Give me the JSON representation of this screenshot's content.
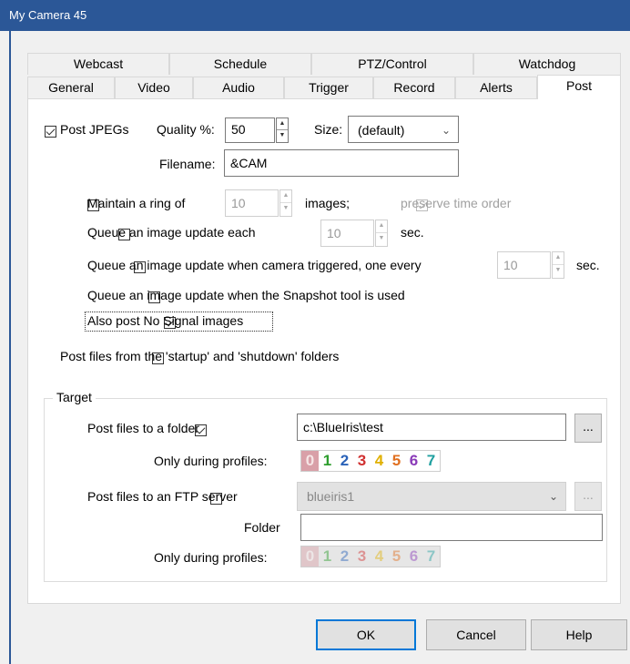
{
  "window": {
    "title": "My Camera 45"
  },
  "tabs_row1": [
    "Webcast",
    "Schedule",
    "PTZ/Control",
    "Watchdog"
  ],
  "tabs_row2": [
    "General",
    "Video",
    "Audio",
    "Trigger",
    "Record",
    "Alerts",
    "Post"
  ],
  "post": {
    "post_jpegs_label": "Post JPEGs",
    "post_jpegs_checked": true,
    "quality_label": "Quality %:",
    "quality_value": "50",
    "size_label": "Size:",
    "size_value": "(default)",
    "filename_label": "Filename:",
    "filename_value": "&CAM",
    "maintain_ring_label": "Maintain a ring of",
    "maintain_ring_checked": false,
    "ring_value": "10",
    "images_label": "images;",
    "preserve_order_label": "preserve time order",
    "preserve_order_checked": true,
    "queue_each_label": "Queue an image update each",
    "queue_each_value": "10",
    "sec_label": "sec.",
    "queue_triggered_label": "Queue an image update when camera triggered, one every",
    "queue_triggered_value": "10",
    "sec_label2": "sec.",
    "queue_snapshot_label": "Queue an image update when the Snapshot tool is used",
    "no_signal_label": "Also post No Signal images",
    "no_signal_checked": true,
    "startup_shutdown_label": "Post files from the 'startup' and 'shutdown' folders"
  },
  "target": {
    "group_label": "Target",
    "folder_label": "Post files to a folder",
    "folder_checked": true,
    "folder_path": "c:\\BlueIris\\test",
    "browse_label": "...",
    "only_during_label": "Only during profiles:",
    "profiles": [
      "0",
      "1",
      "2",
      "3",
      "4",
      "5",
      "6",
      "7"
    ],
    "profile_colors": [
      "#f6e6e6",
      "#2e9e2e",
      "#2a62b8",
      "#d03030",
      "#e0b000",
      "#e07020",
      "#8a3ab8",
      "#20a0a0"
    ],
    "ftp_label": "Post files to an FTP server",
    "ftp_checked": false,
    "ftp_server": "blueiris1",
    "ftp_browse_label": "...",
    "ftp_folder_label": "Folder",
    "ftp_folder_value": "",
    "ftp_only_during_label": "Only during profiles:"
  },
  "buttons": {
    "ok": "OK",
    "cancel": "Cancel",
    "help": "Help"
  }
}
